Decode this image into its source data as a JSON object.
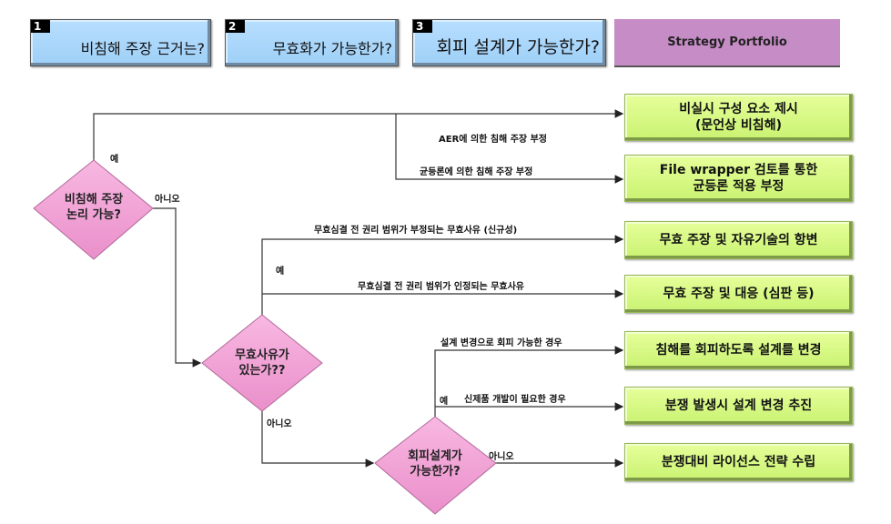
{
  "header": {
    "steps": [
      {
        "number": "1",
        "label": "비침해 주장 근거는?"
      },
      {
        "number": "2",
        "label": "무효화가  가능한가?"
      },
      {
        "number": "3",
        "label": "회피 설계가  가능한가?"
      }
    ],
    "portfolio_label": "Strategy Portfolio"
  },
  "decisions": [
    {
      "line1": "비침해 주장",
      "line2": "논리 가능?",
      "yes": "예",
      "no": "아니오"
    },
    {
      "line1": "무효사유가",
      "line2": "있는가??",
      "yes": "예",
      "no": "아니오"
    },
    {
      "line1": "회피설계가",
      "line2": "가능한가?",
      "yes": "예",
      "no": "아니오"
    }
  ],
  "branch_labels": [
    "AER에 의한 침해 주장 부정",
    "균등론에 의한 침해 주장 부정",
    "무효심결 전 권리 범위가 부정되는 무효사유 (신규성)",
    "무효심결 전 권리 범위가 인정되는 무효사유",
    "설계 변경으로 회피 가능한 경우",
    "신제품 개발이 필요한 경우"
  ],
  "strategies": [
    {
      "line1": "비실시 구성 요소 제시",
      "line2": "(문언상 비침해)"
    },
    {
      "line1": "File wrapper 검토를 통한",
      "line2": "균등론 적용 부정"
    },
    {
      "line1": "무효 주장 및 자유기술의 항변",
      "line2": ""
    },
    {
      "line1": "무효 주장 및 대응 (심판 등)",
      "line2": ""
    },
    {
      "line1": "침해를 회피하도록 설계를 변경",
      "line2": ""
    },
    {
      "line1": "분쟁 발생시 설계 변경 추진",
      "line2": ""
    },
    {
      "line1": "분쟁대비 라이선스 전략 수립",
      "line2": ""
    }
  ],
  "colors": {
    "header_box": "#a9d8fb",
    "portfolio": "#c68cc6",
    "decision": "#f49fd6",
    "strategy": "#d6f886",
    "line": "#333333"
  }
}
